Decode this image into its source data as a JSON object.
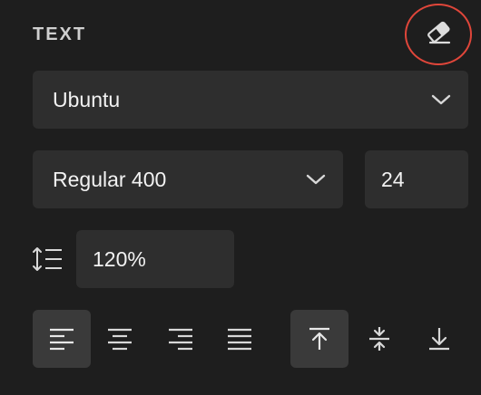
{
  "section": {
    "title": "TEXT"
  },
  "font": {
    "family": "Ubuntu",
    "weight": "Regular 400",
    "size": "24",
    "line_height": "120%"
  },
  "icons": {
    "reset": "eraser-icon",
    "dropdown": "chevron-down-icon",
    "line_height": "line-height-icon",
    "align_left": "align-left-icon",
    "align_center": "align-center-icon",
    "align_right": "align-right-icon",
    "align_justify": "align-justify-icon",
    "valign_top": "vertical-align-top-icon",
    "valign_middle": "vertical-align-middle-icon",
    "valign_bottom": "vertical-align-bottom-icon"
  },
  "state": {
    "horizontal_align": "left",
    "vertical_align": "top"
  },
  "colors": {
    "background": "#1e1e1e",
    "field": "#2e2e2e",
    "active_button": "#3a3a3a",
    "highlight_ring": "#e0463a",
    "text": "#f2f2f2",
    "icon": "#d8d8d8"
  }
}
